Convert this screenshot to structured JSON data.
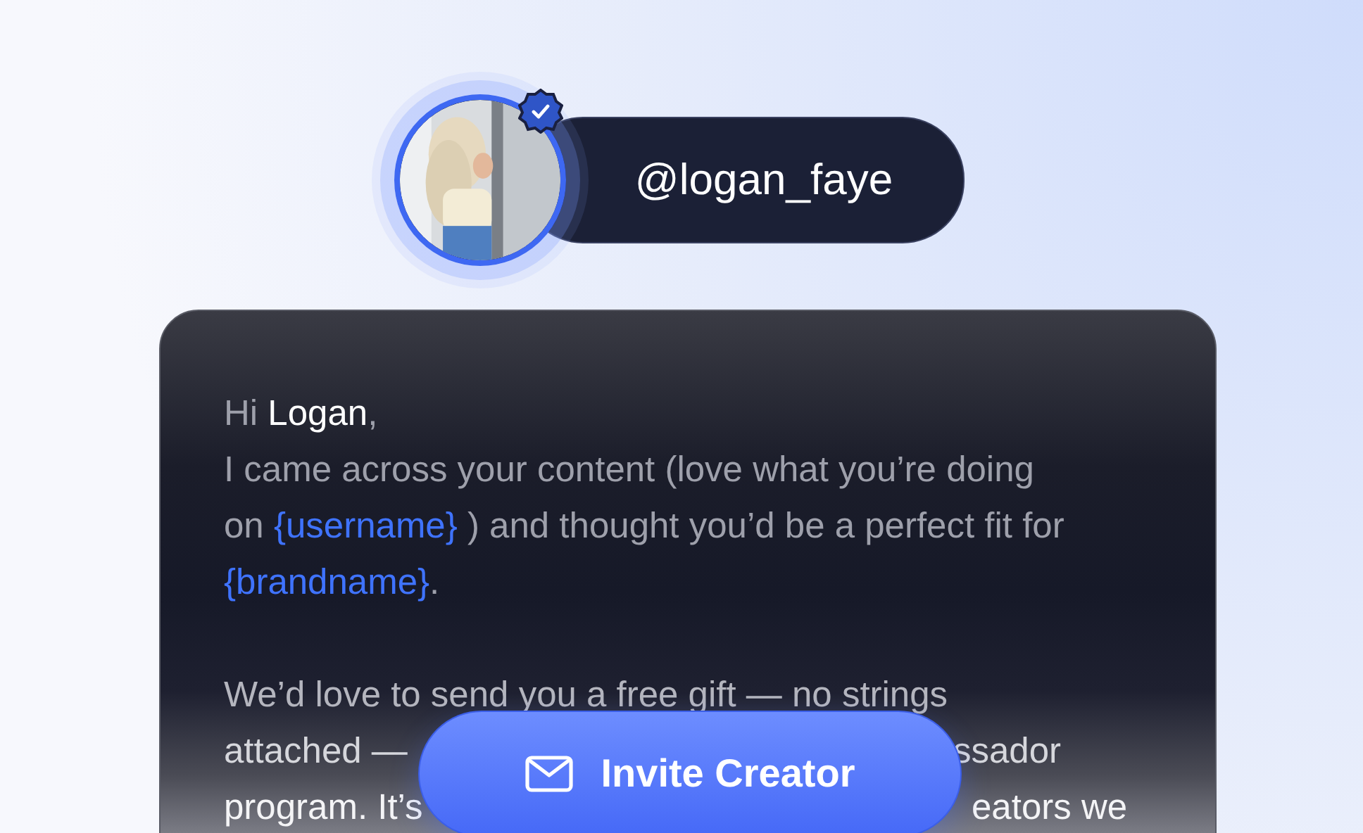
{
  "profile": {
    "avatar": {
      "kind": "picture",
      "verified": true
    },
    "username": "@logan_faye"
  },
  "message": {
    "greeting_paragraph": [
      [
        {
          "kind": "plain",
          "text": "Hi "
        },
        {
          "kind": "name",
          "text": "Logan"
        },
        {
          "kind": "plain",
          "text": ","
        }
      ],
      [
        {
          "kind": "plain",
          "text": "I came across your content (love what you’re doing"
        }
      ],
      [
        {
          "kind": "plain",
          "text": "on "
        },
        {
          "kind": "token",
          "text": "{username}"
        },
        {
          "kind": "plain",
          "text": " ) and thought you’d be a perfect fit for"
        }
      ],
      [
        {
          "kind": "token",
          "text": "{brandname}"
        },
        {
          "kind": "plain",
          "text": "."
        }
      ]
    ],
    "second_paragraph_lines": [
      {
        "left": "We’d love to send you a free gift — no strings"
      },
      {
        "left": "attached —",
        "right": "ssador"
      },
      {
        "left": "program. It’s",
        "right": "eators we"
      }
    ]
  },
  "invite_button": {
    "label": "Invite Creator"
  }
}
